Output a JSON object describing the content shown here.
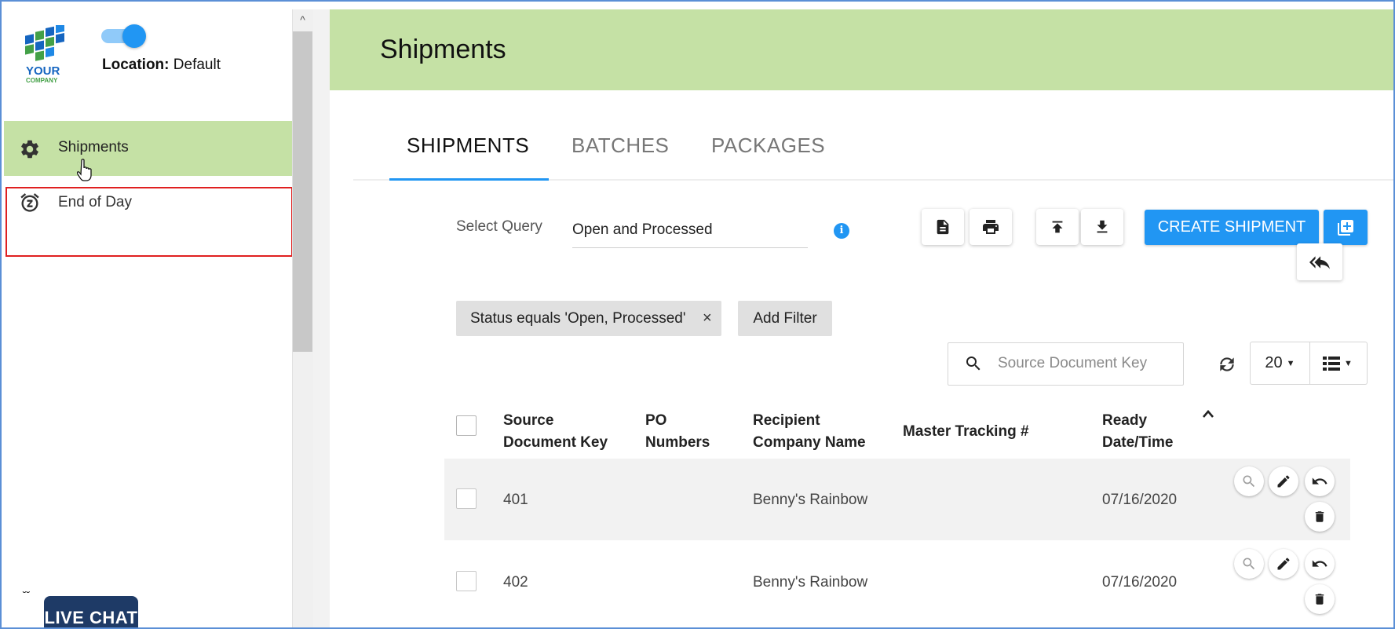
{
  "sidebar": {
    "logo": {
      "word1": "YOUR",
      "word2": "COMPANY",
      "colors": [
        "#1565c0",
        "#43a047"
      ]
    },
    "location_label": "Location:",
    "location_value": "Default",
    "nav": [
      {
        "label": "Shipments",
        "icon": "gear-icon",
        "active": true
      },
      {
        "label": "End of Day",
        "icon": "alarm-snooze-icon",
        "active": false
      }
    ],
    "live_chat": "LIVE CHAT"
  },
  "header": {
    "title": "Shipments",
    "color": "#c5e1a5"
  },
  "tabs": [
    {
      "label": "SHIPMENTS",
      "active": true
    },
    {
      "label": "BATCHES",
      "active": false
    },
    {
      "label": "PACKAGES",
      "active": false
    }
  ],
  "query": {
    "label": "Select Query",
    "value": "Open and Processed"
  },
  "toolbar": {
    "create_label": "CREATE SHIPMENT",
    "accent": "#2196f3",
    "icons": [
      "document-icon",
      "print-icon",
      "upload-icon",
      "download-icon",
      "add-copy-icon",
      "reply-all-icon"
    ]
  },
  "filters": {
    "chips": [
      {
        "label": "Status equals 'Open, Processed'",
        "remove": "×"
      }
    ],
    "add_label": "Add Filter"
  },
  "search": {
    "placeholder": "Source Document Key"
  },
  "pagination": {
    "page_size": "20"
  },
  "table": {
    "columns": [
      {
        "line1": "Source",
        "line2": "Document Key"
      },
      {
        "line1": "PO",
        "line2": "Numbers"
      },
      {
        "line1": "Recipient",
        "line2": "Company Name"
      },
      {
        "line1": "Master Tracking #",
        "line2": ""
      },
      {
        "line1": "Ready",
        "line2": "Date/Time"
      }
    ],
    "rows": [
      {
        "source_key": "401",
        "po_numbers": "",
        "recipient": "Benny's Rainbow",
        "master_tracking": "",
        "ready": "07/16/2020"
      },
      {
        "source_key": "402",
        "po_numbers": "",
        "recipient": "Benny's Rainbow",
        "master_tracking": "",
        "ready": "07/16/2020"
      }
    ]
  }
}
